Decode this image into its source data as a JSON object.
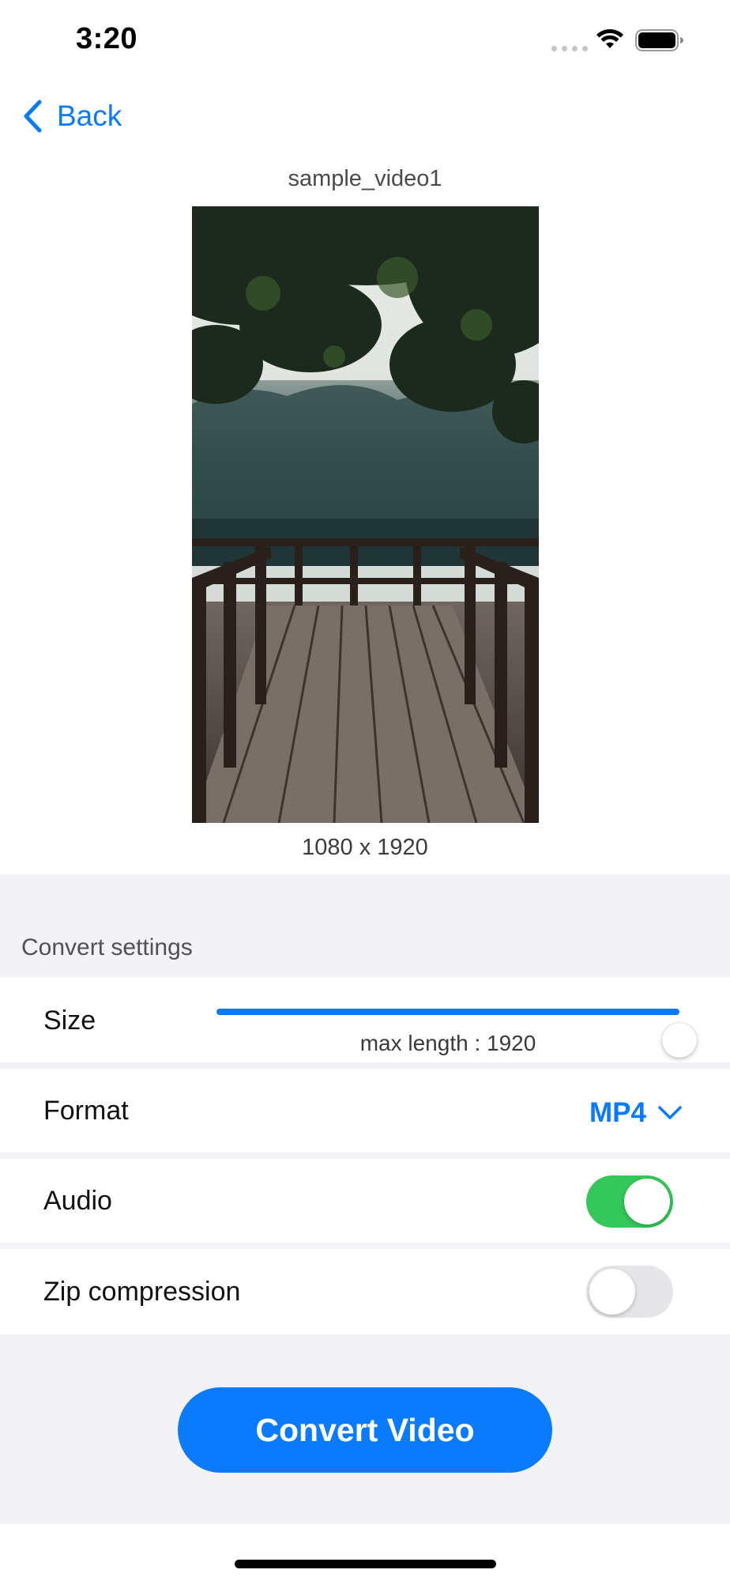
{
  "status_bar": {
    "time": "3:20",
    "icons": [
      "signal-dots-icon",
      "wifi-icon",
      "battery-icon"
    ]
  },
  "nav": {
    "back_label": "Back",
    "back_icon": "chevron-left-icon"
  },
  "video": {
    "title": "sample_video1",
    "dimensions": "1080 x 1920"
  },
  "settings": {
    "header": "Convert settings",
    "size": {
      "label": "Size",
      "value_fraction": 1.0,
      "caption": "max length : 1920"
    },
    "format": {
      "label": "Format",
      "value": "MP4",
      "icon": "chevron-down-icon"
    },
    "audio": {
      "label": "Audio",
      "enabled": true
    },
    "zip": {
      "label": "Zip compression",
      "enabled": false
    }
  },
  "actions": {
    "convert_label": "Convert Video"
  },
  "colors": {
    "accent": "#0a7aff",
    "toggle_on": "#34c759",
    "background": "#f2f2f7"
  }
}
